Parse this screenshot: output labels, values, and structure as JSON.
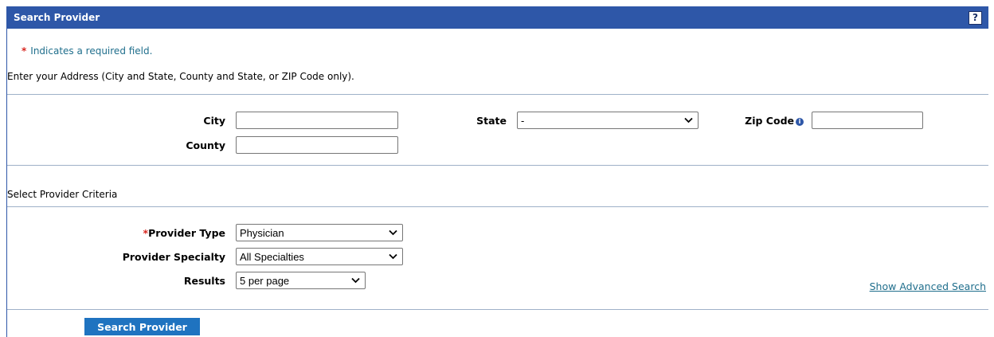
{
  "header": {
    "title": "Search Provider",
    "help_label": "?"
  },
  "required_note": {
    "star": "*",
    "text": "Indicates a required field."
  },
  "address_instructions": "Enter your Address (City and State, County and State, or ZIP Code only).",
  "address": {
    "city_label": "City",
    "city_value": "",
    "state_label": "State",
    "state_value": "-",
    "zip_label": "Zip Code",
    "zip_value": "",
    "county_label": "County",
    "county_value": ""
  },
  "criteria": {
    "section_title": "Select Provider Criteria",
    "provider_type_star": "*",
    "provider_type_label": "Provider Type",
    "provider_type_value": "Physician",
    "specialty_label": "Provider Specialty",
    "specialty_value": "All Specialties",
    "results_label": "Results",
    "results_value": "5 per page",
    "advanced_link": "Show Advanced Search"
  },
  "actions": {
    "search_button": "Search Provider"
  },
  "colors": {
    "header_bg": "#2e57a8",
    "button_bg": "#1f73c0",
    "required_star": "#d8261f",
    "link": "#1f6e8c"
  }
}
